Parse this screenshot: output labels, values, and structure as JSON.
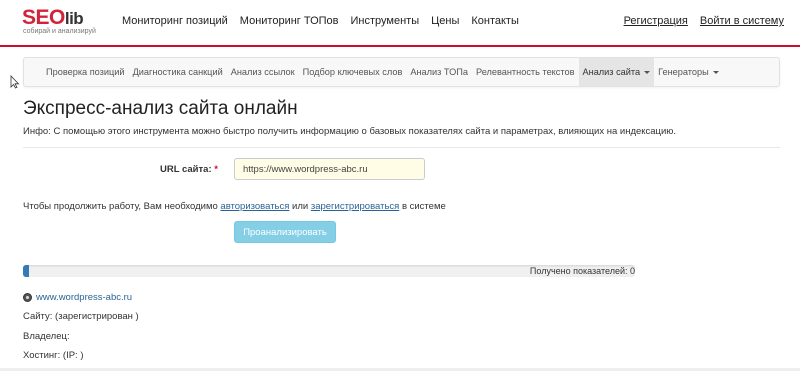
{
  "logo": {
    "brand_main": "SEO",
    "brand_suffix": "lib",
    "tagline": "собирай и анализируй"
  },
  "topnav": {
    "items": [
      "Мониторинг позиций",
      "Мониторинг ТОПов",
      "Инструменты",
      "Цены",
      "Контакты"
    ]
  },
  "auth": {
    "register": "Регистрация",
    "login": "Войти в систему"
  },
  "subnav": {
    "items": [
      "Проверка позиций",
      "Диагностика санкций",
      "Анализ ссылок",
      "Подбор ключевых слов",
      "Анализ ТОПа",
      "Релевантность текстов"
    ],
    "active": "Анализ сайта",
    "generators": "Генераторы"
  },
  "page": {
    "title": "Экспресс-анализ сайта онлайн",
    "info": "Инфо: С помощью этого инструмента можно быстро получить информацию о базовых показателях сайта и параметрах, влияющих на индексацию."
  },
  "form": {
    "url_label": "URL сайта:",
    "required_mark": "*",
    "url_value": "https://www.wordpress-abc.ru",
    "notice_prefix": "Чтобы продолжить работу, Вам необходимо",
    "notice_login": "авторизоваться",
    "notice_or": "или",
    "notice_register": "зарегистрироваться",
    "notice_suffix": "в системе",
    "analyze_button": "Проанализировать"
  },
  "progress": {
    "percent": 1,
    "label": "Получено показателей: 0"
  },
  "result": {
    "site": "www.wordpress-abc.ru",
    "registered": "Сайту: (зарегистрирован )",
    "owner": "Владелец:",
    "hosting": "Хостинг: (IP: )"
  },
  "colors": {
    "brand_red": "#c8102e",
    "button": "#5bc0de",
    "progress": "#337ab7",
    "input_bg": "#fffde6"
  }
}
